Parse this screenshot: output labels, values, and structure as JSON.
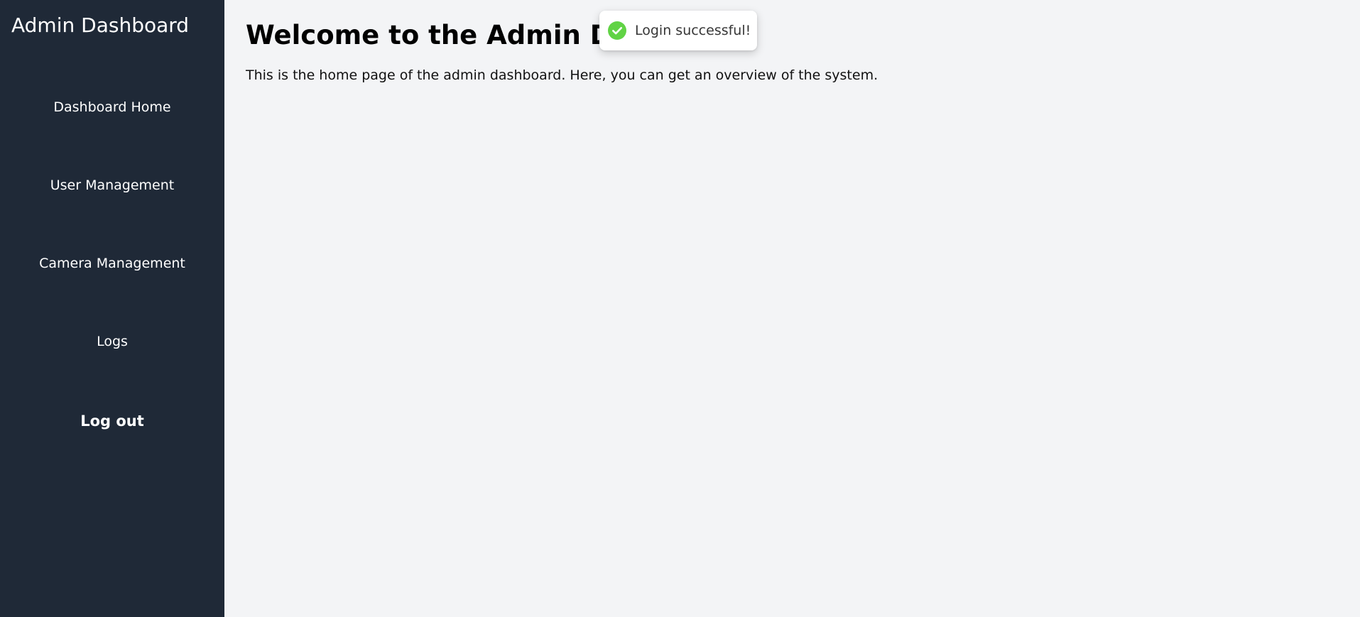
{
  "sidebar": {
    "title": "Admin Dashboard",
    "items": [
      {
        "label": "Dashboard Home"
      },
      {
        "label": "User Management"
      },
      {
        "label": "Camera Management"
      },
      {
        "label": "Logs"
      }
    ],
    "logout_label": "Log out"
  },
  "main": {
    "title": "Welcome to the Admin Dashboard",
    "description": "This is the home page of the admin dashboard. Here, you can get an overview of the system."
  },
  "toast": {
    "message": "Login successful!",
    "icon": "check-circle-icon",
    "color": "#61d345"
  },
  "colors": {
    "sidebar_bg": "#1f2937",
    "main_bg": "#f3f4f6"
  }
}
